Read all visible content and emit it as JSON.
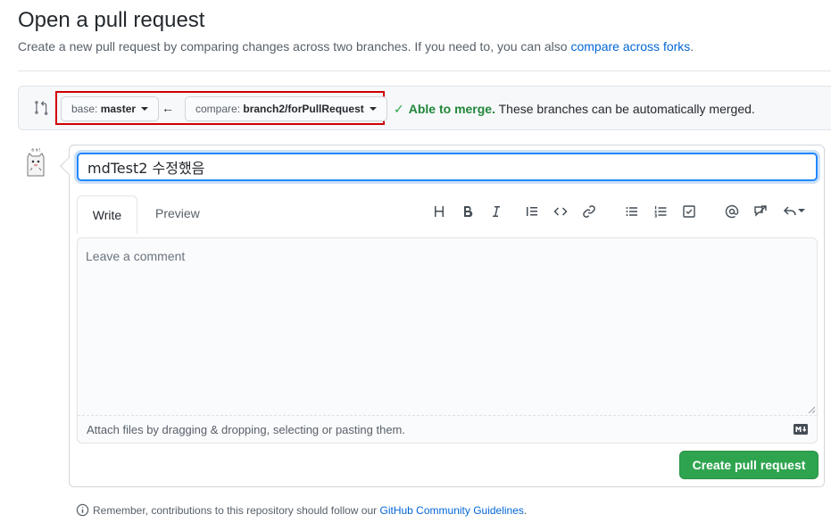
{
  "page": {
    "title": "Open a pull request",
    "subtitle_text": "Create a new pull request by comparing changes across two branches. If you need to, you can also",
    "subtitle_link": "compare across forks",
    "subtitle_end": "."
  },
  "range": {
    "base_prefix": "base:",
    "base_value": "master",
    "compare_prefix": "compare:",
    "compare_value": "branch2/forPullRequest",
    "arrow": "←",
    "merge_check": "✓",
    "merge_status": "Able to merge.",
    "merge_message": "These branches can be automatically merged."
  },
  "form": {
    "title_value": "mdTest2 수정했음",
    "tabs": {
      "write": "Write",
      "preview": "Preview"
    },
    "toolbar": [
      "header-icon",
      "bold-icon",
      "italic-icon",
      "quote-icon",
      "code-icon",
      "link-icon",
      "bulleted-list-icon",
      "numbered-list-icon",
      "task-list-icon",
      "mention-icon",
      "cross-reference-icon",
      "reply-icon"
    ],
    "comment_placeholder": "Leave a comment",
    "attach_text": "Attach files by dragging & dropping, selecting or pasting them.",
    "submit_label": "Create pull request"
  },
  "footer": {
    "text": "Remember, contributions to this repository should follow our",
    "link": "GitHub Community Guidelines",
    "end": "."
  },
  "colors": {
    "accent_link": "#0366d6",
    "success": "#22863a",
    "primary_button": "#2ea44f",
    "highlight_outline": "#d00000",
    "focus": "#2188ff"
  }
}
